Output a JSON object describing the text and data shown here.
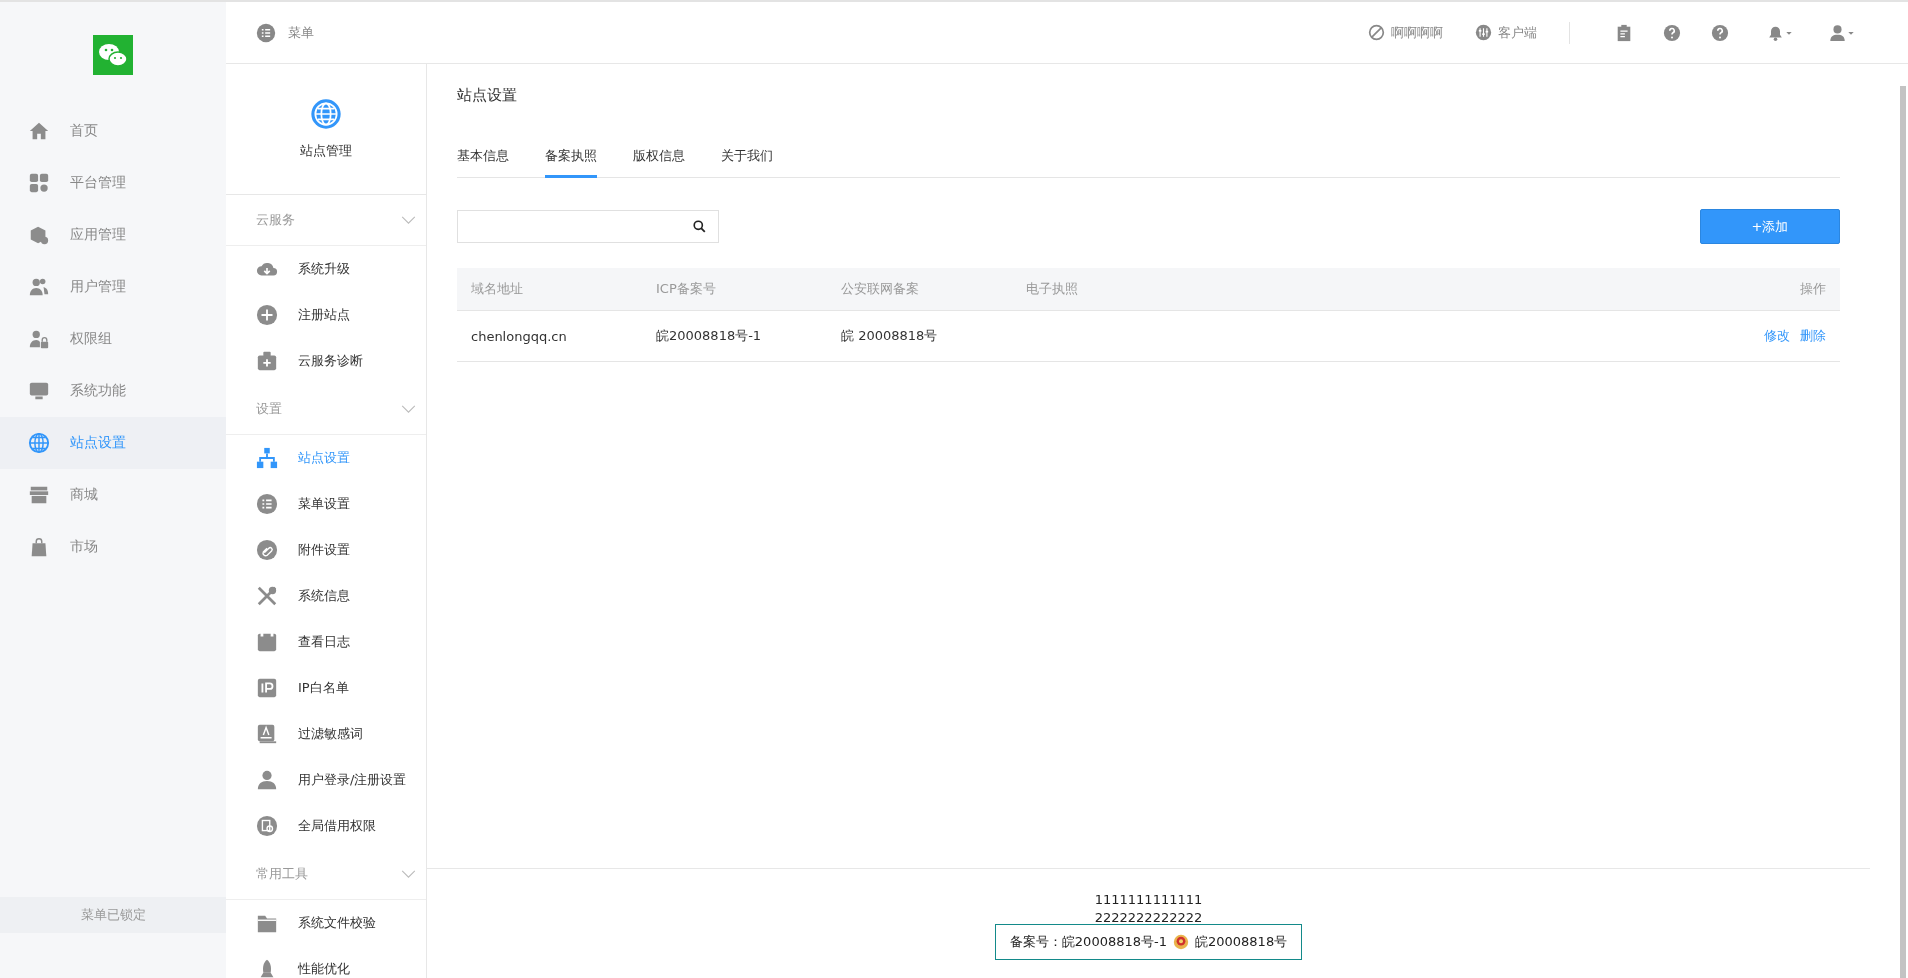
{
  "nav": {
    "items": [
      {
        "label": "首页",
        "selected": false
      },
      {
        "label": "平台管理",
        "selected": false
      },
      {
        "label": "应用管理",
        "selected": false
      },
      {
        "label": "用户管理",
        "selected": false
      },
      {
        "label": "权限组",
        "selected": false
      },
      {
        "label": "系统功能",
        "selected": false
      },
      {
        "label": "站点设置",
        "selected": true
      },
      {
        "label": "商城",
        "selected": false
      },
      {
        "label": "市场",
        "selected": false
      }
    ],
    "lock_label": "菜单已锁定"
  },
  "submenu": {
    "toggle_label": "菜单",
    "title": "站点管理",
    "sections": [
      {
        "title": "云服务",
        "items": [
          {
            "label": "系统升级",
            "selected": false
          },
          {
            "label": "注册站点",
            "selected": false
          },
          {
            "label": "云服务诊断",
            "selected": false
          }
        ]
      },
      {
        "title": "设置",
        "items": [
          {
            "label": "站点设置",
            "selected": true
          },
          {
            "label": "菜单设置",
            "selected": false
          },
          {
            "label": "附件设置",
            "selected": false
          },
          {
            "label": "系统信息",
            "selected": false
          },
          {
            "label": "查看日志",
            "selected": false
          },
          {
            "label": "IP白名单",
            "selected": false
          },
          {
            "label": "过滤敏感词",
            "selected": false
          },
          {
            "label": "用户登录/注册设置",
            "selected": false
          },
          {
            "label": "全局借用权限",
            "selected": false
          }
        ]
      },
      {
        "title": "常用工具",
        "items": [
          {
            "label": "系统文件校验",
            "selected": false
          },
          {
            "label": "性能优化",
            "selected": false
          }
        ]
      }
    ]
  },
  "topbar": {
    "links": [
      "啊啊啊啊",
      "客户端"
    ]
  },
  "page": {
    "title": "站点设置",
    "tabs": [
      {
        "label": "基本信息",
        "selected": false
      },
      {
        "label": "备案执照",
        "selected": true
      },
      {
        "label": "版权信息",
        "selected": false
      },
      {
        "label": "关于我们",
        "selected": false
      }
    ],
    "add_button": "+添加",
    "table": {
      "columns": [
        "域名地址",
        "ICP备案号",
        "公安联网备案",
        "电子执照",
        "操作"
      ],
      "rows": [
        {
          "domain": "chenlongqq.cn",
          "icp": "皖20008818号-1",
          "police": "皖 20008818号",
          "actions": [
            "修改",
            "删除"
          ]
        }
      ]
    }
  },
  "footer": {
    "lines": [
      "1111111111111",
      "2222222222222"
    ],
    "icp": "备案号：皖20008818号-1",
    "police": "皖20008818号"
  }
}
